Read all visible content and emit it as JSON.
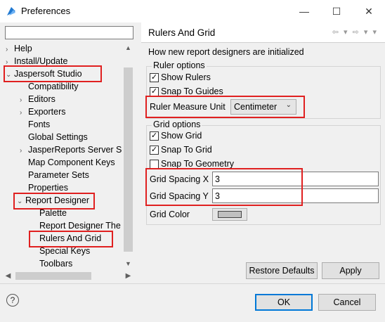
{
  "window": {
    "title": "Preferences",
    "min": "—",
    "max": "☐",
    "close": "✕"
  },
  "colors": {
    "highlight": "#e02020",
    "accent": "#0078d7"
  },
  "filter": {
    "value": ""
  },
  "tree": [
    {
      "label": "Help",
      "arrow": "›"
    },
    {
      "label": "Install/Update",
      "arrow": "›"
    },
    {
      "label": "Jaspersoft Studio",
      "arrow": "⌄"
    },
    {
      "label": "Compatibility",
      "arrow": ""
    },
    {
      "label": "Editors",
      "arrow": "›"
    },
    {
      "label": "Exporters",
      "arrow": "›"
    },
    {
      "label": "Fonts",
      "arrow": ""
    },
    {
      "label": "Global Settings",
      "arrow": ""
    },
    {
      "label": "JasperReports Server Se",
      "arrow": "›"
    },
    {
      "label": "Map Component Keys",
      "arrow": ""
    },
    {
      "label": "Parameter Sets",
      "arrow": ""
    },
    {
      "label": "Properties",
      "arrow": ""
    },
    {
      "label": "Report Designer",
      "arrow": "⌄"
    },
    {
      "label": "Palette",
      "arrow": ""
    },
    {
      "label": "Report Designer The",
      "arrow": ""
    },
    {
      "label": "Rulers And Grid",
      "arrow": ""
    },
    {
      "label": "Special Keys",
      "arrow": ""
    },
    {
      "label": "Toolbars",
      "arrow": ""
    }
  ],
  "page": {
    "title": "Rulers And Grid",
    "nav": "⇦ ▾ ⇨ ▾ ▾",
    "description": "How new report designers are initialized"
  },
  "ruler": {
    "legend": "Ruler options",
    "show_rulers": "Show Rulers",
    "snap_to_guides": "Snap To Guides",
    "measure_label": "Ruler Measure Unit",
    "measure_value": "Centimeter"
  },
  "grid": {
    "legend": "Grid options",
    "show_grid": "Show Grid",
    "snap_to_grid": "Snap To Grid",
    "snap_to_geometry": "Snap To Geometry",
    "spacing_x_label": "Grid Spacing X",
    "spacing_x_value": "3",
    "spacing_y_label": "Grid Spacing Y",
    "spacing_y_value": "3",
    "color_label": "Grid Color",
    "color_value": "#c0c0c0"
  },
  "buttons": {
    "restore": "Restore Defaults",
    "apply": "Apply",
    "ok": "OK",
    "cancel": "Cancel"
  },
  "check_mark": "✓",
  "help_glyph": "?"
}
